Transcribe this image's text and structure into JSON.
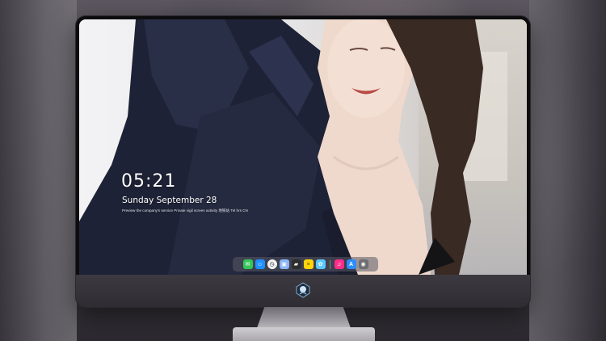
{
  "lockscreen": {
    "time": "05:21",
    "date": "Sunday September  28",
    "caption": "Preview the company's service Private vigil screen activity 地铁站  Tel hrs CN"
  },
  "dock": {
    "apps": [
      {
        "name": "messages",
        "icon": "messages-icon",
        "glyph": "✉",
        "color": "#34c759"
      },
      {
        "name": "finder",
        "icon": "finder-icon",
        "glyph": "☺",
        "color": "#1e90ff"
      },
      {
        "name": "clock",
        "icon": "clock-icon",
        "glyph": "◷",
        "color": "#f2f2f2"
      },
      {
        "name": "preview",
        "icon": "preview-icon",
        "glyph": "▣",
        "color": "#8ab4f8"
      },
      {
        "name": "claquette",
        "icon": "clapperboard-icon",
        "glyph": "▰",
        "color": "#2d2d2d"
      },
      {
        "name": "notes",
        "icon": "notes-icon",
        "glyph": "≡",
        "color": "#ffd60a"
      },
      {
        "name": "photos",
        "icon": "photos-icon",
        "glyph": "✿",
        "color": "#5ac8fa"
      },
      {
        "name": "itunes",
        "icon": "music-icon",
        "glyph": "♫",
        "color": "#ff2d8a"
      },
      {
        "name": "app-store",
        "icon": "app-store-icon",
        "glyph": "A",
        "color": "#2f8cff"
      },
      {
        "name": "camera",
        "icon": "camera-icon",
        "glyph": "◉",
        "color": "#6e6e73"
      }
    ]
  }
}
